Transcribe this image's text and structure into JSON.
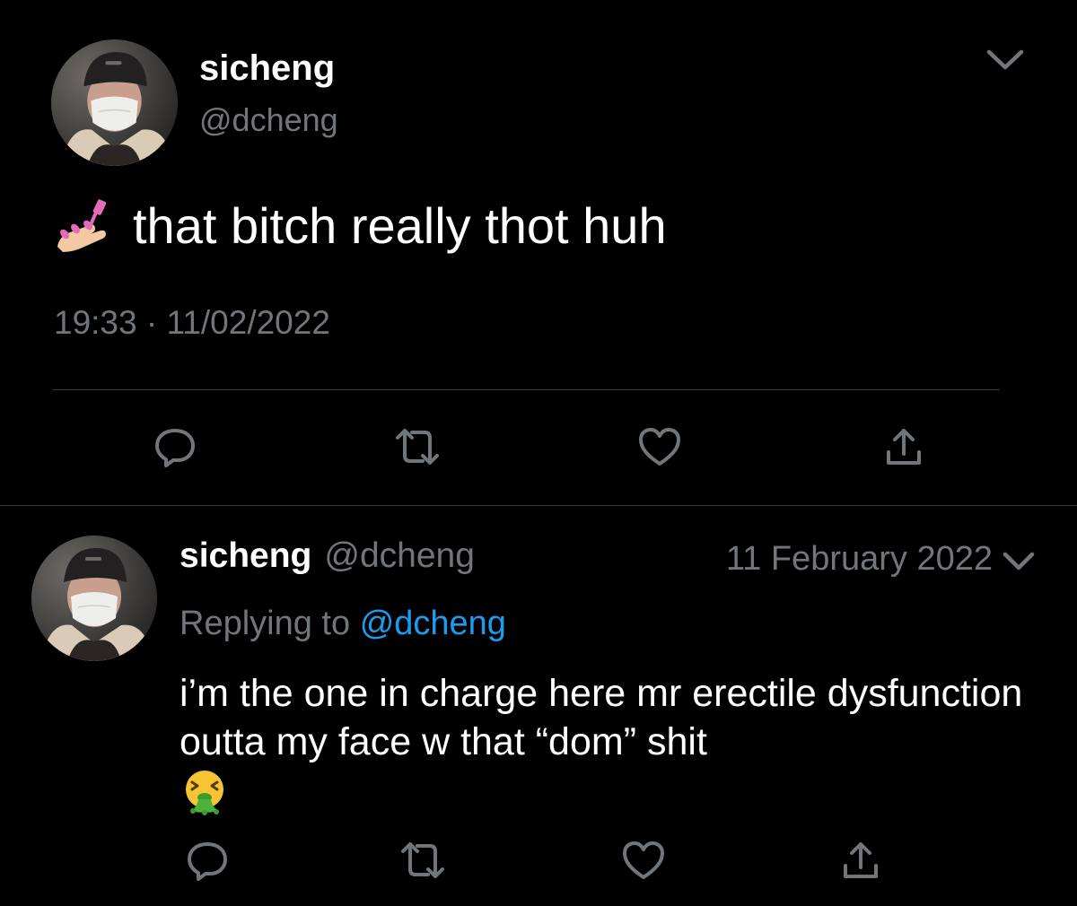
{
  "tweet": {
    "display_name": "sicheng",
    "handle": "@dcheng",
    "text": "that bitch really thot huh",
    "emoji": "nail-polish",
    "time": "19:33",
    "separator": "·",
    "date": "11/02/2022",
    "menu_icon": "chevron-down-icon",
    "actions": [
      "reply-icon",
      "retweet-icon",
      "like-icon",
      "share-icon"
    ]
  },
  "reply": {
    "display_name": "sicheng",
    "handle": "@dcheng",
    "date": "11 February 2022",
    "replying_label": "Replying to",
    "replying_handle": "@dcheng",
    "text": "i’m the one in charge here mr erectile dysfunction outta my face w that “dom” shit",
    "emoji": "vomiting-face",
    "menu_icon": "chevron-down-icon",
    "actions": [
      "reply-icon",
      "retweet-icon",
      "like-icon",
      "share-icon"
    ]
  },
  "colors": {
    "background": "#000000",
    "text": "#ffffff",
    "muted": "#71767b",
    "link": "#1d9bf0",
    "divider": "#38393b"
  }
}
